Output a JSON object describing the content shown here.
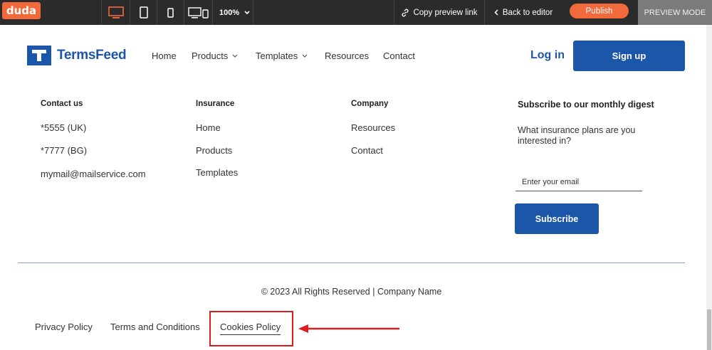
{
  "toolbar": {
    "logo": "duda",
    "zoom": "100%",
    "copy_link": "Copy preview link",
    "back_editor": "Back to editor",
    "publish": "Publish",
    "preview_mode": "PREVIEW MODE",
    "colors": {
      "bar": "#2b2b2b",
      "accent": "#f26a3b",
      "preview": "#7b7b7b"
    }
  },
  "header": {
    "brand": "TermsFeed",
    "nav": [
      "Home",
      "Products",
      "Templates",
      "Resources",
      "Contact"
    ],
    "login": "Log in",
    "signup": "Sign up",
    "brand_color": "#1c56a8"
  },
  "footer": {
    "contact": {
      "title": "Contact us",
      "items": [
        "*5555 (UK)",
        "*7777 (BG)",
        "mymail@mailservice.com"
      ]
    },
    "insurance": {
      "title": "Insurance",
      "items": [
        "Home",
        "Products",
        "Templates"
      ]
    },
    "company": {
      "title": "Company",
      "items": [
        "Resources",
        "Contact"
      ]
    },
    "subscribe": {
      "title": "Subscribe to our monthly digest",
      "question": "What insurance plans are you interested in?",
      "email_placeholder": "Enter your email",
      "button": "Subscribe"
    },
    "copyright": "© 2023 All Rights Reserved | Company Name",
    "legal": [
      "Privacy Policy",
      "Terms and Conditions",
      "Cookies Policy"
    ],
    "highlight_color": "#e01b1b"
  }
}
